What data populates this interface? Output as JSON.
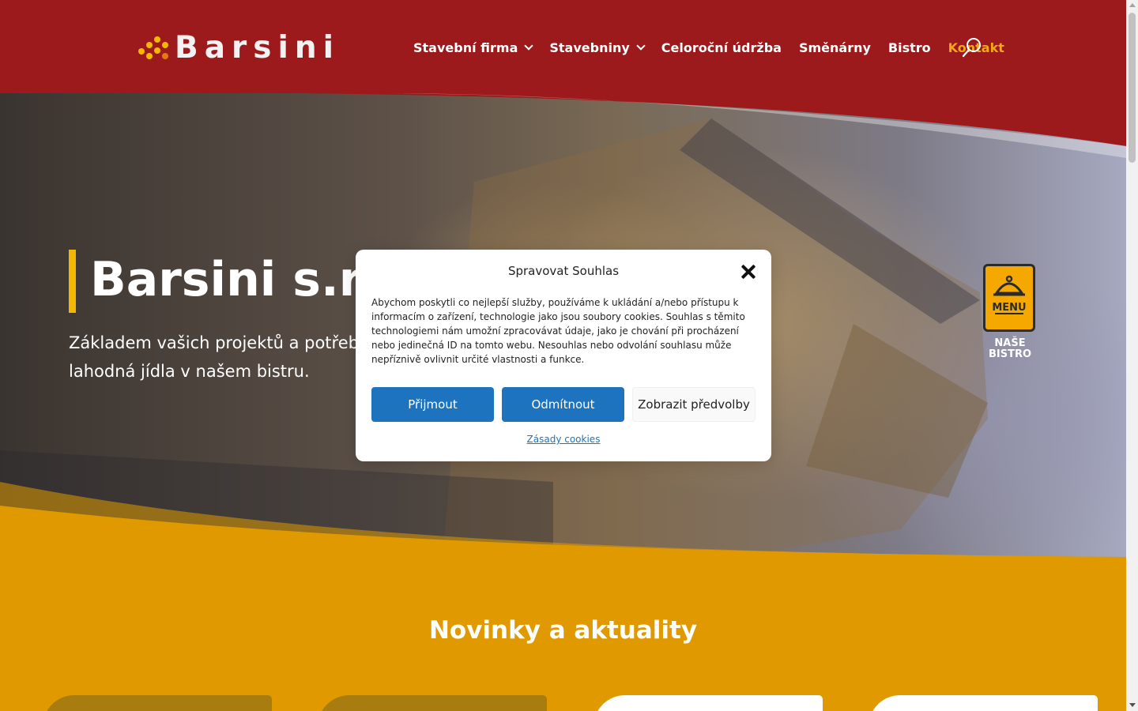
{
  "header": {
    "logo_text": "Barsini",
    "nav": [
      {
        "label": "Stavební firma",
        "has_dropdown": true
      },
      {
        "label": "Stavebniny",
        "has_dropdown": true
      },
      {
        "label": "Celoroční údržba",
        "has_dropdown": false
      },
      {
        "label": "Směnárny",
        "has_dropdown": false
      },
      {
        "label": "Bistro",
        "has_dropdown": false
      },
      {
        "label": "Kontakt",
        "has_dropdown": false,
        "active": true
      }
    ],
    "search_icon": "search-icon"
  },
  "hero": {
    "title": "Barsini s.r.o.",
    "subtitle": "Základem vašich projektů a potřeb, od stavebnin po lahodná jídla v našem bistru."
  },
  "menu_badge": {
    "card_text": "MENU",
    "label_line1": "NAŠE",
    "label_line2": "BISTRO"
  },
  "news": {
    "title": "Novinky a aktuality"
  },
  "cookie_modal": {
    "title": "Spravovat Souhlas",
    "text": "Abychom poskytli co nejlepší služby, používáme k ukládání a/nebo přístupu k informacím o zařízení, technologie jako jsou soubory cookies. Souhlas s těmito technologiemi nám umožní zpracovávat údaje, jako je chování při procházení nebo jedinečná ID na tomto webu. Nesouhlas nebo odvolání souhlasu může nepříznivě ovlivnit určité vlastnosti a funkce.",
    "accept_label": "Přijmout",
    "deny_label": "Odmítnout",
    "prefs_label": "Zobrazit předvolby",
    "policy_link": "Zásady cookies"
  },
  "colors": {
    "header_bg": "#9c1a1c",
    "accent_yellow": "#f5b800",
    "section_bg": "#e09a00",
    "button_blue": "#1e73be",
    "active_nav": "#f2a61a"
  }
}
